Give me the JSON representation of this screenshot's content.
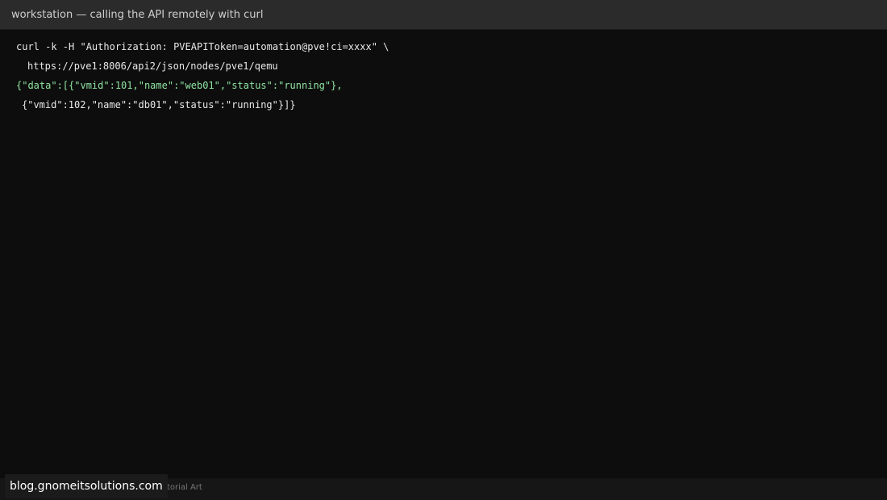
{
  "window": {
    "title": "workstation — calling the API remotely with curl"
  },
  "terminal": {
    "lines": [
      "curl -k -H \"Authorization: PVEAPIToken=automation@pve!ci=xxxx\" \\",
      "https://pve1:8006/api2/json/nodes/pve1/qemu",
      "{\"data\":[{\"vmid\":101,\"name\":\"web01\",\"status\":\"running\"},",
      "{\"vmid\":102,\"name\":\"db01\",\"status\":\"running\"}]}"
    ]
  },
  "footer": {
    "credit": "Tutorial Art"
  },
  "watermark": {
    "text": "blog.gnomeitsolutions.com"
  },
  "colors": {
    "background": "#0d0d0d",
    "titlebar": "#2b2b2b",
    "output_green": "#8fe3a1",
    "text": "#e8e8e8"
  }
}
